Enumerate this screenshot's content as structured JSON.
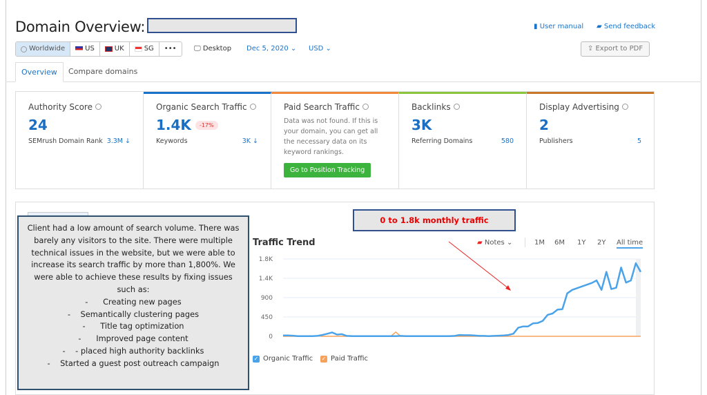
{
  "header": {
    "title": "Domain Overview:",
    "user_manual": "User manual",
    "send_feedback": "Send feedback",
    "export": "Export to PDF"
  },
  "filters": {
    "regions": [
      "Worldwide",
      "US",
      "UK",
      "SG",
      "•••"
    ],
    "device": "Desktop",
    "date": "Dec 5, 2020",
    "currency": "USD"
  },
  "tabs": [
    "Overview",
    "Compare domains"
  ],
  "cards": [
    {
      "title": "Authority Score",
      "value": "24",
      "sub_label": "SEMrush Domain Rank",
      "sub_value": "3.3M ↓",
      "accent": "transparent"
    },
    {
      "title": "Organic Search Traffic",
      "value": "1.4K",
      "badge": "-17%",
      "sub_label": "Keywords",
      "sub_value": "3K ↓",
      "accent": "#1a73c8"
    },
    {
      "title": "Paid Search Traffic",
      "text": "Data was not found. If this is your domain, you can get all the necessary data on its keyword rankings.",
      "button": "Go to Position Tracking",
      "accent": "#f0893c"
    },
    {
      "title": "Backlinks",
      "value": "3K",
      "sub_label": "Referring Domains",
      "sub_value": "580",
      "accent": "#8cc63f"
    },
    {
      "title": "Display Advertising",
      "value": "2",
      "sub_label": "Publishers",
      "sub_value": "5",
      "accent": "#c8782a"
    }
  ],
  "callout": {
    "intro": "Client had a low amount of search volume. There was barely any visitors to the site. There were multiple technical issues in the website, but we were able to increase its search traffic by more than 1,800%. We were able to achieve these results by fixing issues such as:",
    "items": [
      "-      Creating new pages",
      "-    Semantically clustering pages",
      "-      Title tag optimization",
      "-      Improved page content",
      "-    - placed high authority backlinks",
      "-    Started a guest post outreach campaign"
    ]
  },
  "annotation": "0 to 1.8k monthly traffic",
  "chart_data": {
    "type": "line",
    "title": "Traffic Trend",
    "notes_label": "Notes",
    "ranges": [
      "1M",
      "6M",
      "1Y",
      "2Y",
      "All time"
    ],
    "selected_range": "All time",
    "y_tick_labels": [
      "0",
      "450",
      "900",
      "1.4K",
      "1.8K"
    ],
    "ylim": [
      0,
      1800
    ],
    "grid": true,
    "legend": "bottom-left",
    "series": [
      {
        "name": "Organic Traffic",
        "color": "#4aa3e8",
        "values": [
          20,
          20,
          15,
          5,
          5,
          5,
          5,
          10,
          30,
          60,
          90,
          40,
          50,
          10,
          5,
          5,
          5,
          5,
          5,
          5,
          5,
          5,
          5,
          5,
          10,
          5,
          5,
          5,
          5,
          5,
          5,
          5,
          5,
          5,
          5,
          10,
          30,
          25,
          25,
          20,
          10,
          10,
          5,
          10,
          15,
          20,
          30,
          60,
          200,
          230,
          230,
          300,
          310,
          360,
          500,
          530,
          620,
          630,
          1000,
          1080,
          1120,
          1160,
          1200,
          1240,
          1300,
          1080,
          1500,
          1100,
          1130,
          1600,
          1250,
          1300,
          1700,
          1500
        ]
      },
      {
        "name": "Paid Traffic",
        "color": "#f5a25d",
        "values": [
          0,
          0,
          0,
          0,
          0,
          0,
          0,
          10,
          0,
          0,
          0,
          0,
          0,
          0,
          10,
          0,
          0,
          0,
          0,
          0,
          0,
          0,
          0,
          100,
          0,
          0,
          0,
          0,
          0,
          0,
          0,
          0,
          0,
          0,
          0,
          0,
          0,
          0,
          0,
          0,
          0,
          0,
          0,
          0,
          0,
          0,
          0,
          0,
          0,
          0,
          0,
          0,
          0,
          0,
          0,
          0,
          0,
          0,
          0,
          0,
          0,
          0,
          0,
          0,
          0,
          0,
          0,
          0,
          0,
          0,
          0,
          0,
          0,
          0
        ]
      }
    ]
  }
}
